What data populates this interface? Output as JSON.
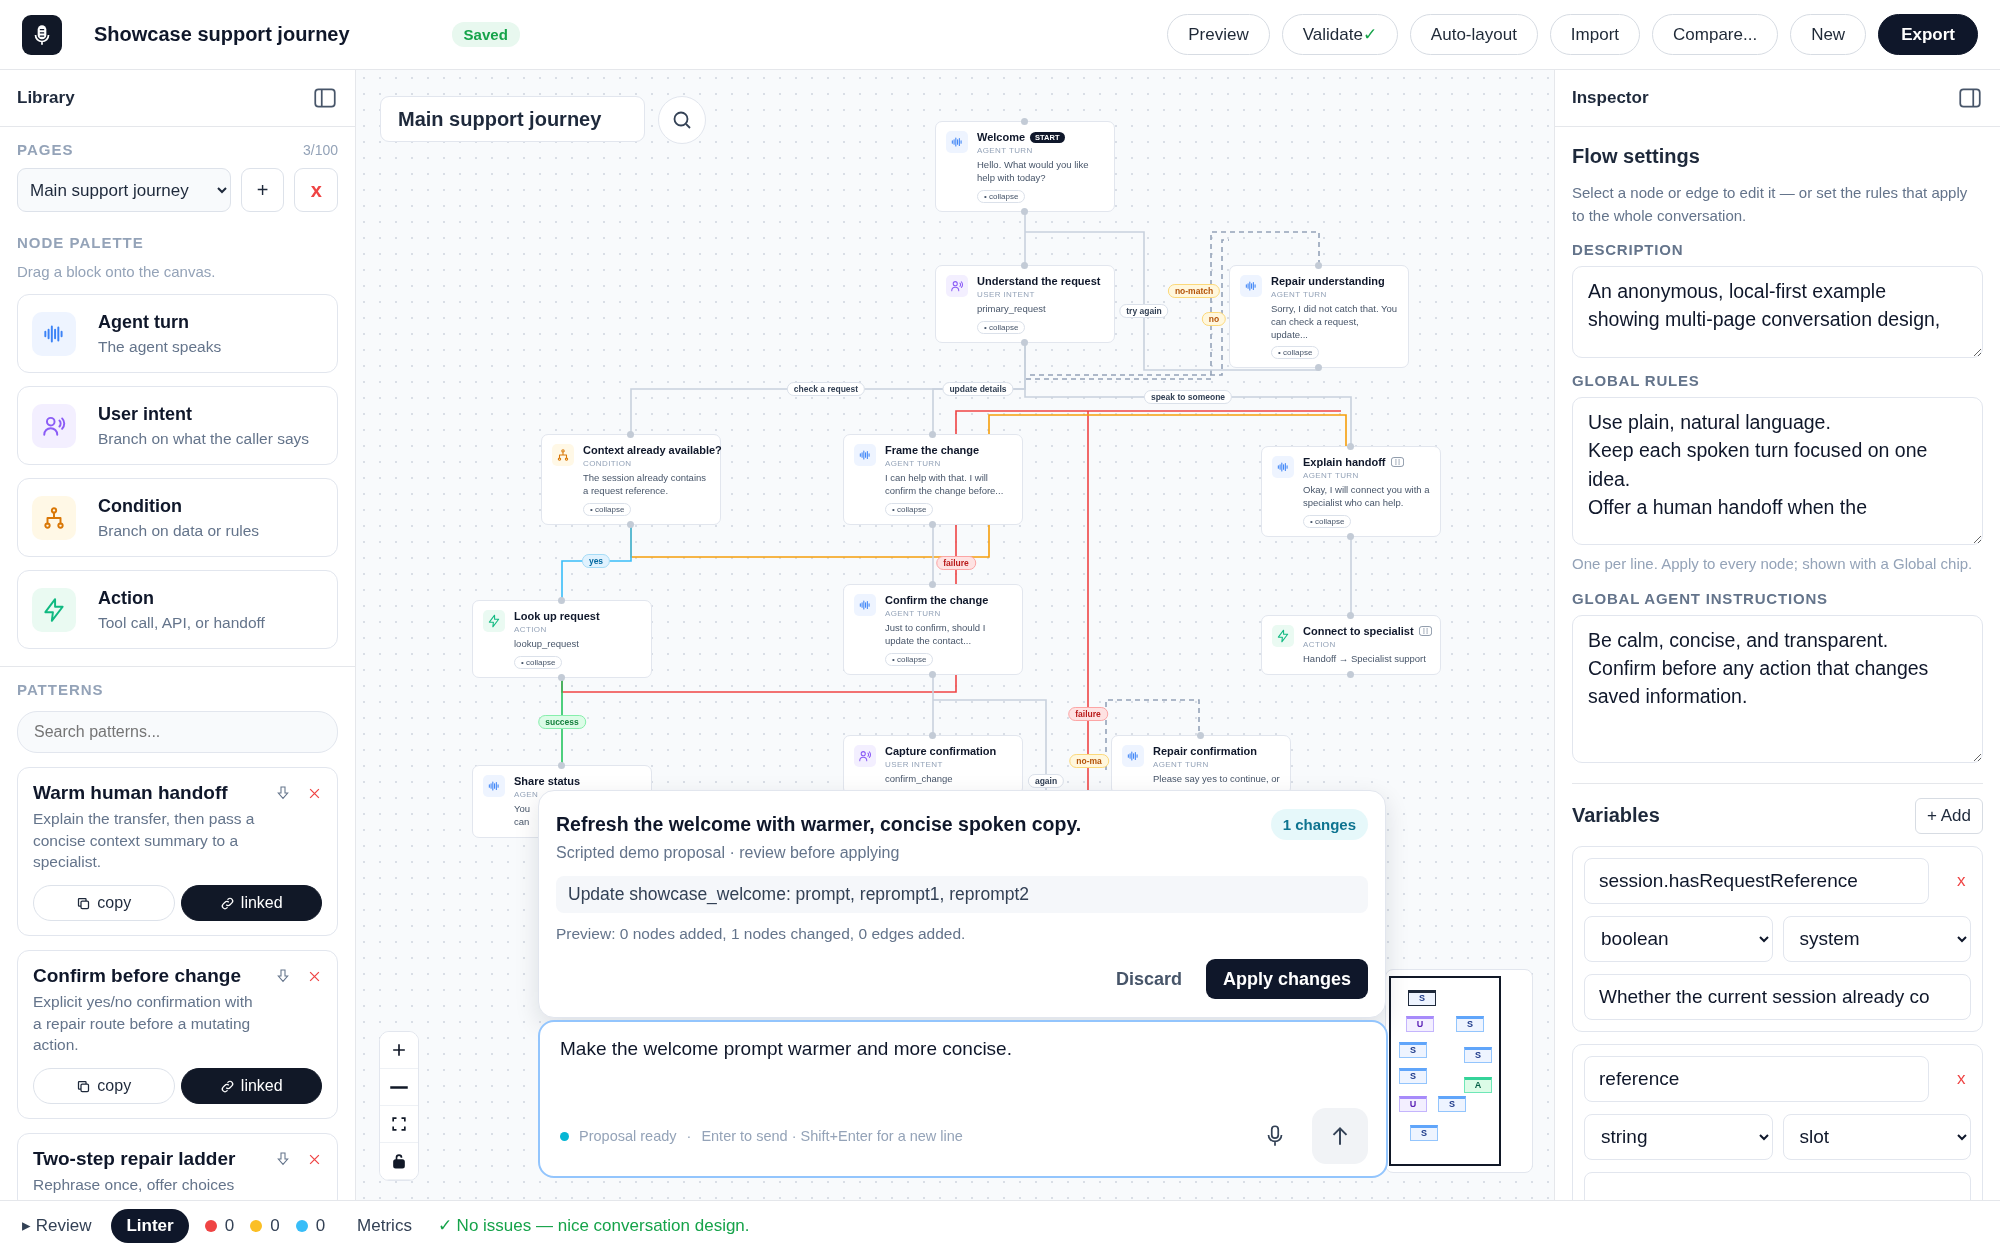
{
  "app": {
    "title": "Showcase support journey",
    "status": "Saved"
  },
  "toolbar": [
    {
      "label": "Preview",
      "kind": "plain"
    },
    {
      "label": "Validate",
      "check": "✓",
      "kind": "plain"
    },
    {
      "label": "Auto-layout",
      "kind": "plain"
    },
    {
      "label": "Import",
      "kind": "plain"
    },
    {
      "label": "Compare...",
      "kind": "plain"
    },
    {
      "label": "New",
      "kind": "plain"
    },
    {
      "label": "Export",
      "kind": "primary"
    }
  ],
  "library": {
    "title": "Library",
    "pages_label": "PAGES",
    "pages_count": "3/100",
    "page_select": "Main support journey",
    "add": "+",
    "remove": "x",
    "palette_label": "NODE PALETTE",
    "palette_hint": "Drag a block onto the canvas.",
    "palette": [
      {
        "kind": "agent",
        "title": "Agent turn",
        "desc": "The agent speaks"
      },
      {
        "kind": "intent",
        "title": "User intent",
        "desc": "Branch on what the caller says"
      },
      {
        "kind": "condition",
        "title": "Condition",
        "desc": "Branch on data or rules"
      },
      {
        "kind": "action",
        "title": "Action",
        "desc": "Tool call, API, or handoff"
      }
    ],
    "patterns_label": "PATTERNS",
    "patterns_search": {
      "placeholder": "Search patterns..."
    },
    "patterns": [
      {
        "title": "Warm human handoff",
        "desc": "Explain the transfer, then pass a concise context summary to a specialist.",
        "copy": "copy",
        "linked": "linked"
      },
      {
        "title": "Confirm before change",
        "desc": "Explicit yes/no confirmation with a repair route before a mutating action.",
        "copy": "copy",
        "linked": "linked"
      },
      {
        "title": "Two-step repair ladder",
        "desc": "Rephrase once, offer choices"
      }
    ]
  },
  "canvas": {
    "page_title": "Main support journey",
    "nodes": [
      {
        "title": "Welcome",
        "badge": "START",
        "global_chip": false,
        "kind": "agent",
        "kind_label": "AGENT TURN",
        "text": "Hello. What would you like help with today?",
        "collapse": "• collapse"
      },
      {
        "title": "Understand the request",
        "global_chip": false,
        "kind": "intent",
        "kind_label": "USER INTENT",
        "text": "primary_request",
        "collapse": "• collapse"
      },
      {
        "title": "Repair understanding",
        "global_chip": false,
        "kind": "agent",
        "kind_label": "AGENT TURN",
        "text": "Sorry, I did not catch that. You can check a request, update...",
        "collapse": "• collapse"
      },
      {
        "title": "Context already available?",
        "global_chip": false,
        "kind": "condition",
        "kind_label": "CONDITION",
        "text": "The session already contains a request reference.",
        "collapse": "• collapse"
      },
      {
        "title": "Frame the change",
        "global_chip": false,
        "kind": "agent",
        "kind_label": "AGENT TURN",
        "text": "I can help with that. I will confirm the change before...",
        "collapse": "• collapse"
      },
      {
        "title": "Explain handoff",
        "global_chip": true,
        "kind": "agent",
        "kind_label": "AGENT TURN",
        "text": "Okay, I will connect you with a specialist who can help.",
        "collapse": "• collapse"
      },
      {
        "title": "Look up request",
        "global_chip": false,
        "kind": "action",
        "kind_label": "ACTION",
        "text": "lookup_request",
        "collapse": "• collapse"
      },
      {
        "title": "Confirm the change",
        "global_chip": false,
        "kind": "agent",
        "kind_label": "AGENT TURN",
        "text": "Just to confirm, should I update the contact...",
        "collapse": "• collapse"
      },
      {
        "title": "Connect to specialist",
        "global_chip": true,
        "kind": "action",
        "kind_label": "ACTION",
        "text": "Handoff → Specialist support"
      },
      {
        "title": "Share status",
        "global_chip": false,
        "kind": "agent",
        "kind_label": "AGEN",
        "text": "You\ncan"
      },
      {
        "title": "Capture confirmation",
        "global_chip": false,
        "kind": "intent",
        "kind_label": "USER INTENT",
        "text": "confirm_change"
      },
      {
        "title": "Repair confirmation",
        "global_chip": false,
        "kind": "agent",
        "kind_label": "AGENT TURN",
        "text": "Please say yes to continue, or"
      }
    ],
    "edges": [
      {
        "kind": "plain"
      },
      {
        "kind": "nomatch",
        "label": "no-match"
      },
      {
        "kind": "plain",
        "label": "try again"
      },
      {
        "kind": "nomatch",
        "label": "no"
      },
      {
        "kind": "plain",
        "label": "check a request"
      },
      {
        "kind": "plain",
        "label": "update details"
      },
      {
        "kind": "plain",
        "label": "speak to someone"
      },
      {
        "kind": "failure",
        "label": "failure"
      },
      {
        "kind": "failure",
        "label": "failure"
      },
      {
        "kind": "branch"
      },
      {
        "kind": "plain"
      },
      {
        "kind": "yes",
        "label": "yes"
      },
      {
        "kind": "plain"
      },
      {
        "kind": "plain"
      },
      {
        "kind": "success",
        "label": "success"
      },
      {
        "kind": "plain",
        "label": "again"
      },
      {
        "kind": "nomatch",
        "label": "no-ma"
      }
    ],
    "minimap": [
      {
        "label": "S",
        "kind": "agent",
        "selected": true
      },
      {
        "label": "U",
        "kind": "intent",
        "selected": false
      },
      {
        "label": "S",
        "kind": "agent",
        "selected": false
      },
      {
        "label": "S",
        "kind": "agent",
        "selected": false
      },
      {
        "label": "S",
        "kind": "agent",
        "selected": false
      },
      {
        "label": "S",
        "kind": "agent",
        "selected": false
      },
      {
        "label": "A",
        "kind": "action",
        "selected": false
      },
      {
        "label": "U",
        "kind": "intent",
        "selected": false
      },
      {
        "label": "S",
        "kind": "agent",
        "selected": false
      },
      {
        "label": "S",
        "kind": "agent",
        "selected": false
      }
    ]
  },
  "proposal": {
    "title": "Refresh the welcome with warmer, concise spoken copy.",
    "badge": "1 changes",
    "subtitle": "Scripted demo proposal · review before applying",
    "change": "Update showcase_welcome: prompt, reprompt1, reprompt2",
    "preview": "Preview: 0 nodes added, 1 nodes changed, 0 edges added.",
    "discard": "Discard",
    "apply": "Apply changes"
  },
  "chat": {
    "value": "Make the welcome prompt warmer and more concise.",
    "status": "Proposal ready",
    "separator": "·",
    "hint": "Enter to send · Shift+Enter for a new line"
  },
  "inspector": {
    "title": "Inspector",
    "heading": "Flow settings",
    "help": "Select a node or edge to edit it — or set the rules that apply to the whole conversation.",
    "fields": [
      {
        "label": "DESCRIPTION",
        "value": "An anonymous, local-first example\nshowing multi-page conversation design,"
      },
      {
        "label": "GLOBAL RULES",
        "value": "Use plain, natural language.\nKeep each spoken turn focused on one idea.\nOffer a human handoff when the",
        "hint": "One per line. Apply to every node; shown with a Global chip."
      },
      {
        "label": "GLOBAL AGENT INSTRUCTIONS",
        "value": "Be calm, concise, and transparent.\nConfirm before any action that changes saved information."
      }
    ],
    "variables_title": "Variables",
    "add": "+ Add",
    "variables": [
      {
        "name": "session.hasRequestReference",
        "remove": "x",
        "type": "boolean",
        "source": "system",
        "description": "Whether the current session already co"
      },
      {
        "name": "reference",
        "remove": "x",
        "type": "string",
        "source": "slot"
      }
    ]
  },
  "status_bar": {
    "review": "▸ Review",
    "linter": "Linter",
    "counts": [
      {
        "color": "#ef4444",
        "value": "0"
      },
      {
        "color": "#fbbf24",
        "value": "0"
      },
      {
        "color": "#38bdf8",
        "value": "0"
      }
    ],
    "metrics": "Metrics",
    "message": "✓ No issues — nice conversation design."
  }
}
